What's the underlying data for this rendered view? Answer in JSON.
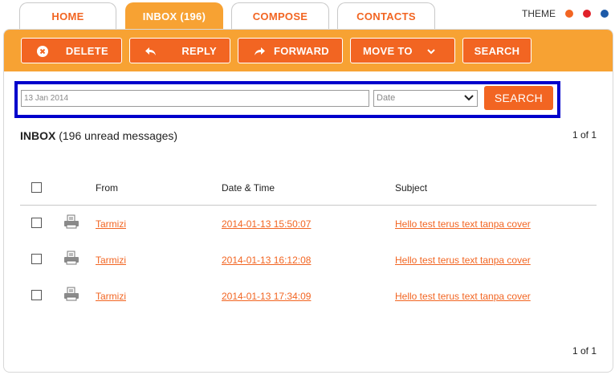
{
  "tabs": [
    {
      "label": "HOME"
    },
    {
      "label": "INBOX (196)"
    },
    {
      "label": "COMPOSE"
    },
    {
      "label": "CONTACTS"
    }
  ],
  "theme": {
    "label": "THEME",
    "colors": [
      "#f26522",
      "#e0212a",
      "#1d5aa8"
    ]
  },
  "toolbar": {
    "delete_label": "DELETE",
    "reply_label": "REPLY",
    "forward_label": "FORWARD",
    "moveto_label": "MOVE TO",
    "search_label": "SEARCH"
  },
  "search": {
    "date_value": "13 Jan 2014",
    "field_selected": "Date",
    "button_label": "SEARCH"
  },
  "inbox": {
    "title": "INBOX",
    "subtitle": "(196 unread messages)",
    "pager_top": "1 of 1",
    "pager_bottom": "1 of 1"
  },
  "table": {
    "headers": {
      "from": "From",
      "datetime": "Date & Time",
      "subject": "Subject"
    },
    "rows": [
      {
        "from": "Tarmizi",
        "datetime": "2014-01-13 15:50:07",
        "subject": "Hello test terus text tanpa cover"
      },
      {
        "from": "Tarmizi",
        "datetime": "2014-01-13 16:12:08",
        "subject": "Hello test terus text tanpa cover"
      },
      {
        "from": "Tarmizi",
        "datetime": "2014-01-13 17:34:09",
        "subject": "Hello test terus text tanpa cover"
      }
    ]
  },
  "colors": {
    "accent": "#f26522",
    "toolbar": "#f7a233",
    "highlight_border": "#0000cc"
  }
}
